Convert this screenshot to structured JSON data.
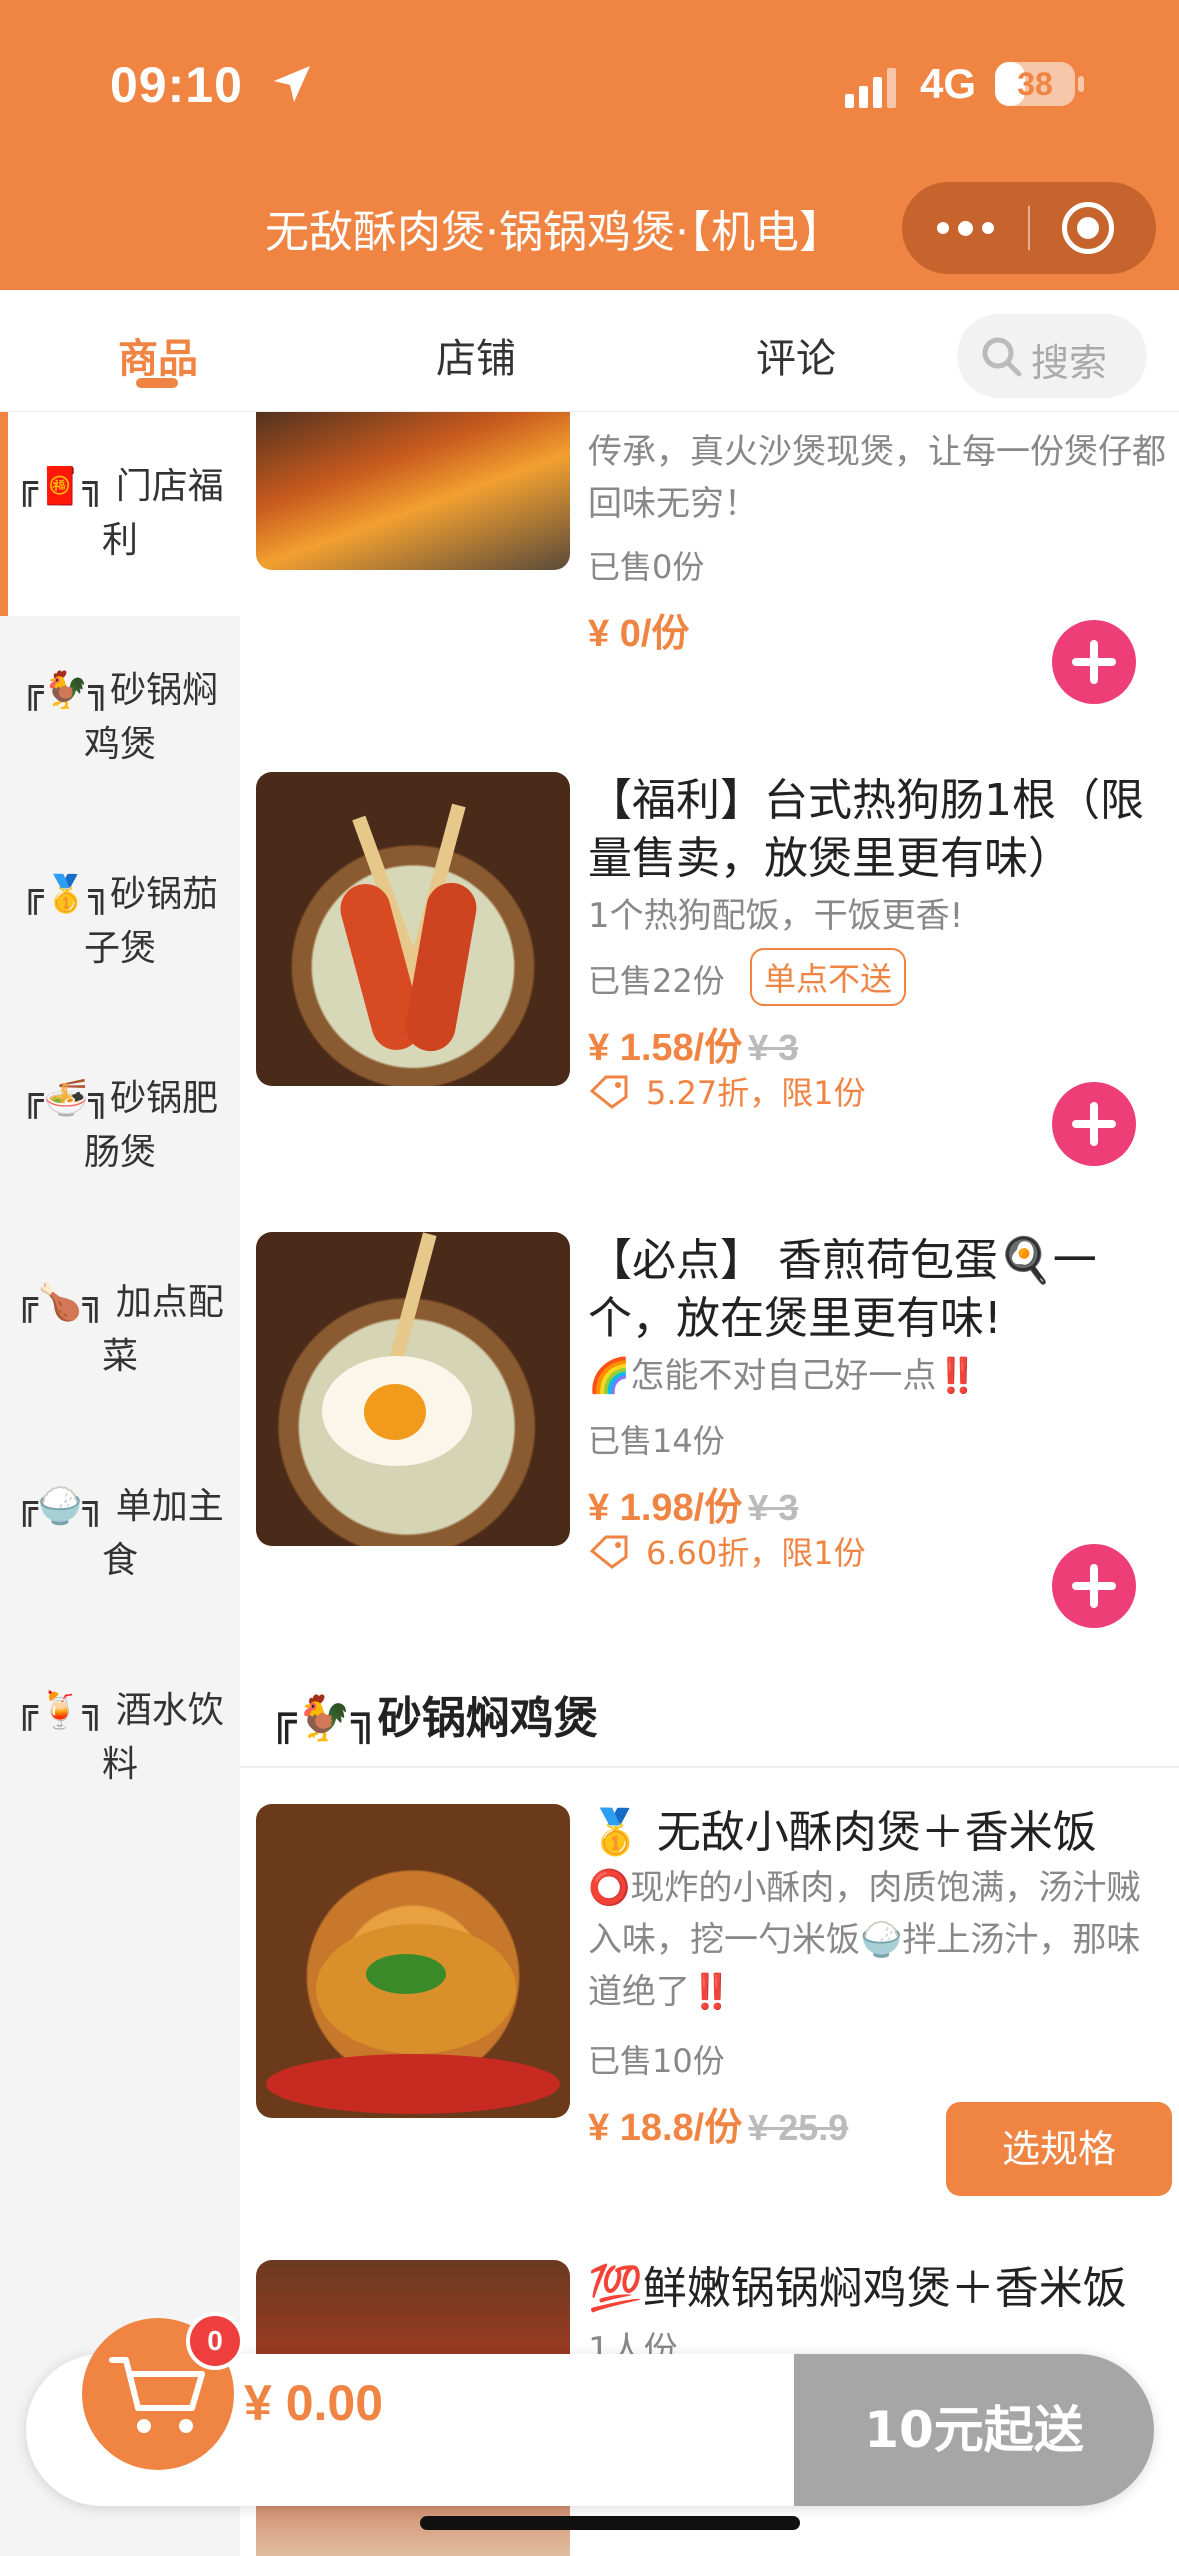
{
  "status_bar": {
    "time": "09:10",
    "network": "4G",
    "battery": "38",
    "battery_level": 0.38
  },
  "header": {
    "title": "无敌酥肉煲·锅锅鸡煲·【机电】"
  },
  "tabs": [
    {
      "label": "商品",
      "active": true
    },
    {
      "label": "店铺",
      "active": false
    },
    {
      "label": "评论",
      "active": false
    }
  ],
  "search": {
    "placeholder": "搜索"
  },
  "sidebar": {
    "items": [
      {
        "label": "╔🧧╗ 门店福利",
        "active": true
      },
      {
        "label": "╔🐓╗砂锅焖鸡煲",
        "active": false
      },
      {
        "label": "╔🥇╗砂锅茄子煲",
        "active": false
      },
      {
        "label": "╔🍜╗砂锅肥肠煲",
        "active": false
      },
      {
        "label": "╔🍗╗ 加点配菜",
        "active": false
      },
      {
        "label": "╔🍚╗ 单加主食",
        "active": false
      },
      {
        "label": "╔🍹╗ 酒水饮料",
        "active": false
      }
    ]
  },
  "products": [
    {
      "title_partial": "传承，真火沙煲现煲，让每一份煲仔都回味无穷！",
      "sold": "已售0份",
      "price": "¥ 0/份"
    },
    {
      "title": "【福利】台式热狗肠1根（限量售卖，放煲里更有味）",
      "desc": "1个热狗配饭，干饭更香!",
      "sold": "已售22份",
      "badge": "单点不送",
      "price": "¥ 1.58/份",
      "original_price": "¥ 3",
      "discount": "5.27折，限1份"
    },
    {
      "title": "【必点】 香煎荷包蛋🍳一个，放在煲里更有味!",
      "desc": "🌈怎能不对自己好一点‼️",
      "sold": "已售14份",
      "price": "¥ 1.98/份",
      "original_price": "¥ 3",
      "discount": "6.60折，限1份"
    }
  ],
  "section": {
    "title": "╔🐓╗砂锅焖鸡煲"
  },
  "section_products": [
    {
      "title": "🥇 无敌小酥肉煲＋香米饭",
      "desc": "⭕现炸的小酥肉，肉质饱满，汤汁贼入味，挖一勺米饭🍚拌上汤汁，那味道绝了‼️",
      "sold": "已售10份",
      "price": "¥ 18.8/份",
      "original_price": "¥ 25.9",
      "button": "选规格"
    },
    {
      "title": "💯鲜嫩锅锅焖鸡煲＋香米饭",
      "desc": "1人份"
    }
  ],
  "cart": {
    "count": "0",
    "total": "¥ 0.00",
    "checkout_label": "10元起送"
  },
  "colors": {
    "brand": "#ef8443",
    "add_button": "#ee3e78",
    "checkout_disabled": "#a6a6a6"
  }
}
